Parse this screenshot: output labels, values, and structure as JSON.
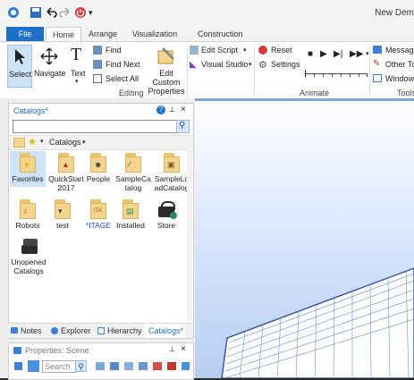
{
  "window": {
    "title": "New Dem"
  },
  "ribbon": {
    "tabs": [
      {
        "label": "File"
      },
      {
        "label": "Home"
      },
      {
        "label": "Arrange"
      },
      {
        "label": "Visualization"
      },
      {
        "label": "Construction"
      }
    ],
    "groups": {
      "editing": {
        "label": "Editing",
        "select": "Select",
        "navigate": "Navigate",
        "text": "Text",
        "find": "Find",
        "find_next": "Find Next",
        "select_all": "Select All",
        "edit_custom_properties": "Edit Custom Properties"
      },
      "script": {
        "edit_script": "Edit Script",
        "visual_studio": "Visual Studio"
      },
      "animate": {
        "label": "Animate",
        "reset": "Reset",
        "settings": "Settings"
      },
      "tools": {
        "label": "Tools",
        "messages": "Message",
        "other_tools": "Other To",
        "windows": "Windows"
      }
    }
  },
  "catalogs_panel": {
    "title": "Catalogs*",
    "search_value": "",
    "breadcrumb": "Catalogs",
    "items": [
      {
        "label": "Favorites"
      },
      {
        "label": "QuickStart 2017"
      },
      {
        "label": "People"
      },
      {
        "label": "SampleCa talog"
      },
      {
        "label": "SampleLo adCatalog"
      },
      {
        "label": "Robots"
      },
      {
        "label": "test"
      },
      {
        "label": "*ITAGE"
      },
      {
        "label": "Installed"
      },
      {
        "label": "Store"
      },
      {
        "label": "Unopened Catalogs"
      }
    ],
    "bottom_tabs": [
      "Notes",
      "Explorer",
      "Hierarchy",
      "Catalogs*"
    ]
  },
  "properties_panel": {
    "title": "Properties: Scene",
    "search_placeholder": "Search"
  },
  "colors": {
    "accent": "#1f6fc6",
    "viewport_top": "#ffffff",
    "viewport_bottom": "#b8cdf2"
  }
}
